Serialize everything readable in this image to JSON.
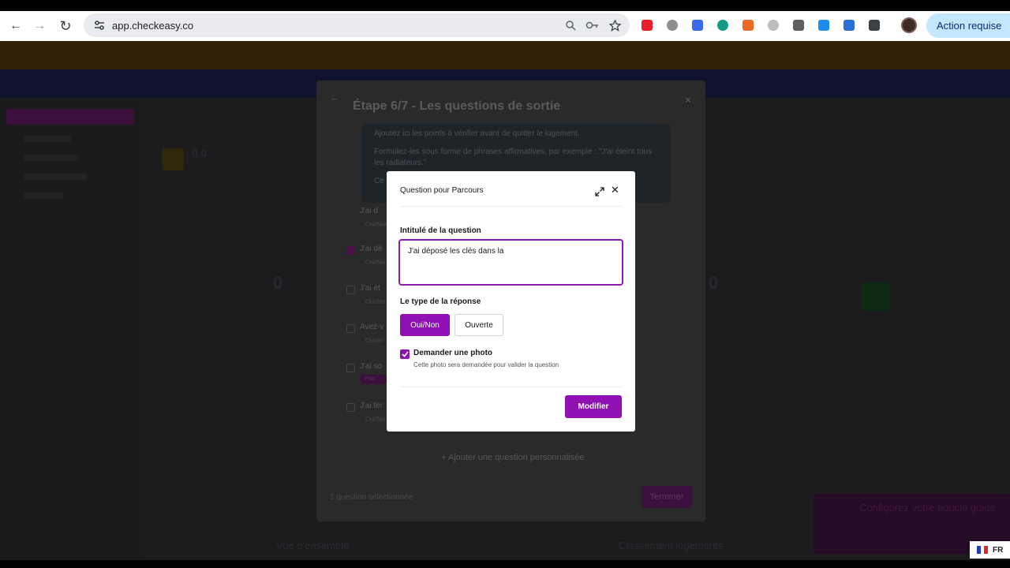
{
  "browser": {
    "url": "app.checkeasy.co",
    "action_pill": "Action requise",
    "back_icon": "←",
    "forward_icon": "→",
    "reload_icon": "↻",
    "extension_colors": [
      "#e8202a",
      "#8e8e8e",
      "#3b6cf0",
      "#0f9d8a",
      "#ee6a22",
      "#bdbdbd",
      "#5f5f5f",
      "#1a8cf0",
      "#2b6fd6",
      "#3c4043"
    ]
  },
  "background": {
    "sections": [
      "Vue d'ensemble",
      "Classement logements"
    ],
    "stat_left": "0.0",
    "number_left": "0",
    "number_right": "0",
    "toast": "Configurez votre boucle guide",
    "lang": "FR"
  },
  "step_modal": {
    "title": "Étape 6/7 - Les questions de sortie",
    "info_lines": [
      "Ajoutez ici les points à vérifier avant de quitter le logement.",
      "Formulez-les sous forme de phrases affirmatives, par exemple : \"J'ai éteint tous les radiateurs.\"",
      "Ce"
    ],
    "items": [
      {
        "text": "J'ai d",
        "sub": "Oui/Non",
        "checked": false
      },
      {
        "text": "J'ai dé",
        "sub": "Oui/No",
        "checked": true
      },
      {
        "text": "J'ai ét",
        "sub": "Oui/No",
        "checked": false
      },
      {
        "text": "Avez-v",
        "sub": "Ouver",
        "checked": false
      },
      {
        "text": "J'ai so",
        "sub": "Pho",
        "checked": false
      },
      {
        "text": "J'ai fer",
        "sub": "Oui/No",
        "checked": false
      }
    ],
    "add_question": "Ajouter une question personnalisée",
    "selected_count": "1 question sélectionnée",
    "finish_label": "Terminer"
  },
  "dialog": {
    "title_prefix": "Question pour",
    "title_target": "Parcours",
    "question_label": "Intitulé de la question",
    "question_value": "J'ai déposé les clés dans la ",
    "type_label": "Le type de la réponse",
    "type_options": [
      "Oui/Non",
      "Ouverte"
    ],
    "photo_label": "Demander une photo",
    "photo_help": "Cette photo sera demandée pour valider la question",
    "photo_checked": true,
    "submit_label": "Modifier"
  },
  "colors": {
    "accent": "#8f10b3",
    "accent_border": "#8f1bb0"
  }
}
